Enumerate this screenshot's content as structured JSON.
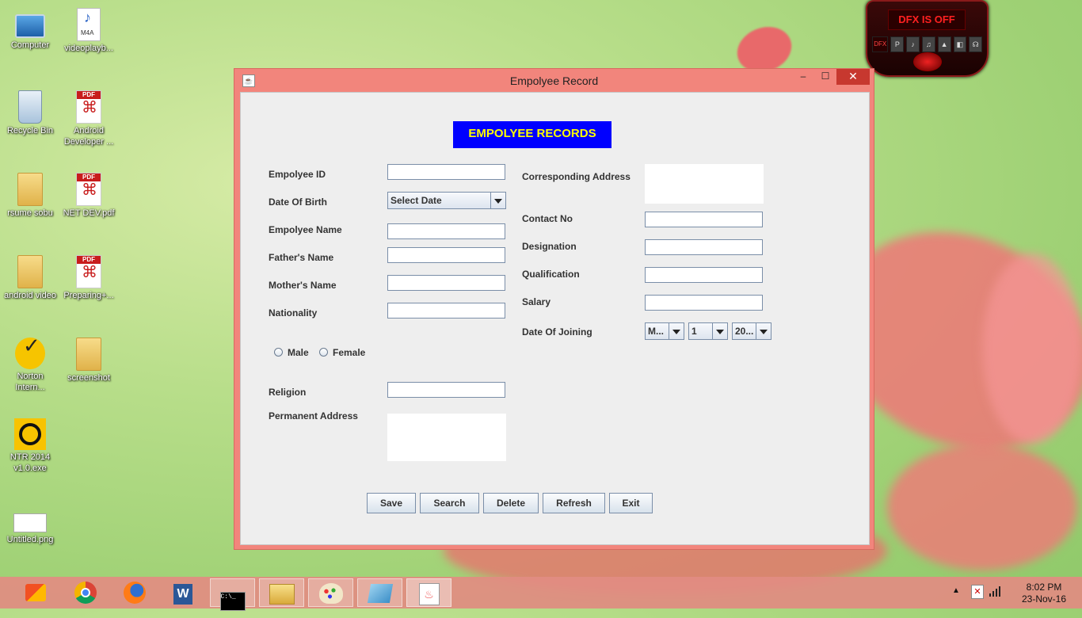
{
  "desktop": {
    "icons": [
      {
        "label": "Computer"
      },
      {
        "label": "videoplayb..."
      },
      {
        "label": "Recycle Bin"
      },
      {
        "label": "Android Developer ..."
      },
      {
        "label": "rsume sobu"
      },
      {
        "label": "NET DEV.pdf"
      },
      {
        "label": "android video"
      },
      {
        "label": "Preparing+..."
      },
      {
        "label": "Norton Intern..."
      },
      {
        "label": "screenshot"
      },
      {
        "label": "NTR 2014 v1.0.exe"
      },
      {
        "label": "Untitled.png"
      }
    ],
    "music_badge": "M4A",
    "pdf_badge": "PDF"
  },
  "dfx": {
    "status": "DFX IS OFF",
    "buttons": [
      "DFX",
      "P",
      "♪",
      "♫",
      "▲",
      "◧",
      "☊"
    ]
  },
  "window": {
    "title": "Empolyee Record",
    "minimize": "–",
    "maximize": "☐",
    "close": "✕",
    "header": "EMPOLYEE RECORDS",
    "left_labels": {
      "employee_id": "Empolyee ID",
      "dob": "Date Of Birth",
      "name": "Empolyee Name",
      "father": "Father's Name",
      "mother": "Mother's Name",
      "nationality": "Nationality",
      "religion": "Religion",
      "permanent_address": "Permanent Address"
    },
    "right_labels": {
      "corresponding_address": "Corresponding Address",
      "contact": "Contact No",
      "designation": "Designation",
      "qualification": "Qualification",
      "salary": "Salary",
      "doj": "Date Of Joining"
    },
    "dob_combo": "Select Date",
    "doj_month": "M...",
    "doj_day": "1",
    "doj_year": "20...",
    "gender": {
      "male": "Male",
      "female": "Female"
    },
    "buttons": {
      "save": "Save",
      "search": "Search",
      "delete": "Delete",
      "refresh": "Refresh",
      "exit": "Exit"
    }
  },
  "taskbar": {
    "cmd_text": "C:\\_",
    "word_letter": "W",
    "java_glyph": "♨",
    "clock_time": "8:02 PM",
    "clock_date": "23-Nov-16"
  }
}
